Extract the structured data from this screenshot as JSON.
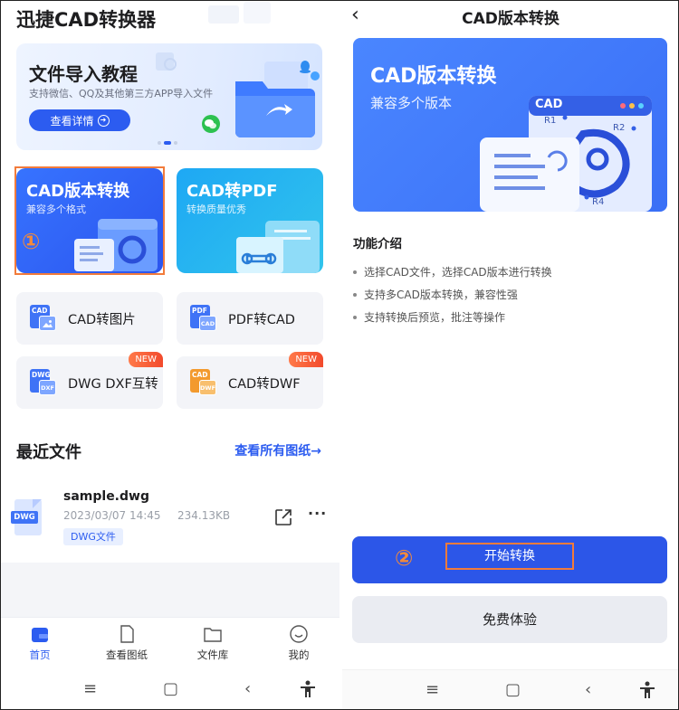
{
  "left": {
    "app_title": "迅捷CAD转换器",
    "banner": {
      "title": "文件导入教程",
      "subtitle": "支持微信、QQ及其他第三方APP导入文件",
      "button": "查看详情"
    },
    "features": [
      {
        "title": "CAD版本转换",
        "subtitle": "兼容多个格式"
      },
      {
        "title": "CAD转PDF",
        "subtitle": "转换质量优秀"
      }
    ],
    "marker_1": "①",
    "tools": [
      {
        "label": "CAD转图片",
        "badge": "",
        "icon_a": "CAD",
        "icon_b": ""
      },
      {
        "label": "PDF转CAD",
        "badge": "",
        "icon_a": "PDF",
        "icon_b": "CAD"
      },
      {
        "label": "DWG DXF互转",
        "badge": "NEW",
        "icon_a": "DWG",
        "icon_b": "DXF"
      },
      {
        "label": "CAD转DWF",
        "badge": "NEW",
        "icon_a": "CAD",
        "icon_b": "DWF"
      }
    ],
    "recent": {
      "title": "最近文件",
      "view_all": "查看所有图纸"
    },
    "file": {
      "icon_tag": "DWG",
      "name": "sample.dwg",
      "date": "2023/03/07  14:45",
      "size": "234.13KB",
      "type": "DWG文件"
    },
    "nav": [
      {
        "label": "首页",
        "icon": "home-icon"
      },
      {
        "label": "查看图纸",
        "icon": "drawing-icon"
      },
      {
        "label": "文件库",
        "icon": "folder-icon"
      },
      {
        "label": "我的",
        "icon": "profile-icon"
      }
    ]
  },
  "right": {
    "page_title": "CAD版本转换",
    "hero": {
      "title": "CAD版本转换",
      "subtitle": "兼容多个版本",
      "window_label": "CAD",
      "r1": "R1",
      "r2": "R2",
      "r4": "R4"
    },
    "intro_title": "功能介绍",
    "intro_items": [
      "选择CAD文件，选择CAD版本进行转换",
      "支持多CAD版本转换，兼容性强",
      "支持转换后预览，批注等操作"
    ],
    "marker_2": "②",
    "start_button": "开始转换",
    "trial_button": "免费体验"
  },
  "colors": {
    "primary": "#2c5cf0",
    "highlight": "#f27b3b",
    "cad_card": "#3773ff",
    "pdf_card": "#1ea8f4",
    "new_badge": "#f24a2c"
  }
}
